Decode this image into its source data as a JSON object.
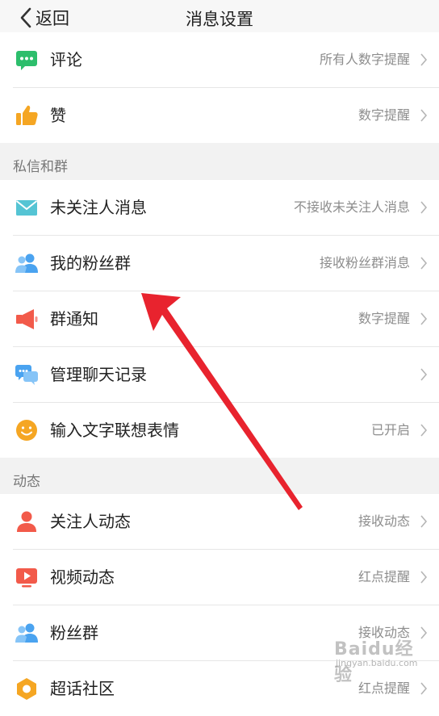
{
  "nav": {
    "back_label": "返回",
    "title": "消息设置"
  },
  "sections": {
    "private": "私信和群",
    "activity": "动态"
  },
  "rows": {
    "comment": {
      "label": "评论",
      "value": "所有人数字提醒"
    },
    "like": {
      "label": "赞",
      "value": "数字提醒"
    },
    "stranger": {
      "label": "未关注人消息",
      "value": "不接收未关注人消息"
    },
    "fangroup": {
      "label": "我的粉丝群",
      "value": "接收粉丝群消息"
    },
    "groupnotice": {
      "label": "群通知",
      "value": "数字提醒"
    },
    "chathistory": {
      "label": "管理聊天记录",
      "value": ""
    },
    "emoji": {
      "label": "输入文字联想表情",
      "value": "已开启"
    },
    "follow": {
      "label": "关注人动态",
      "value": "接收动态"
    },
    "video": {
      "label": "视频动态",
      "value": "红点提醒"
    },
    "fans": {
      "label": "粉丝群",
      "value": "接收动态"
    },
    "supertopic": {
      "label": "超话社区",
      "value": "红点提醒"
    }
  },
  "watermark": {
    "logo": "Baidu经验",
    "url": "jingyan.baidu.com"
  },
  "colors": {
    "annotation_arrow": "#e8232e",
    "accent_green": "#2dbe6c",
    "accent_blue": "#4aa3f0",
    "accent_orange": "#f5a623",
    "accent_red": "#f25a4a"
  }
}
